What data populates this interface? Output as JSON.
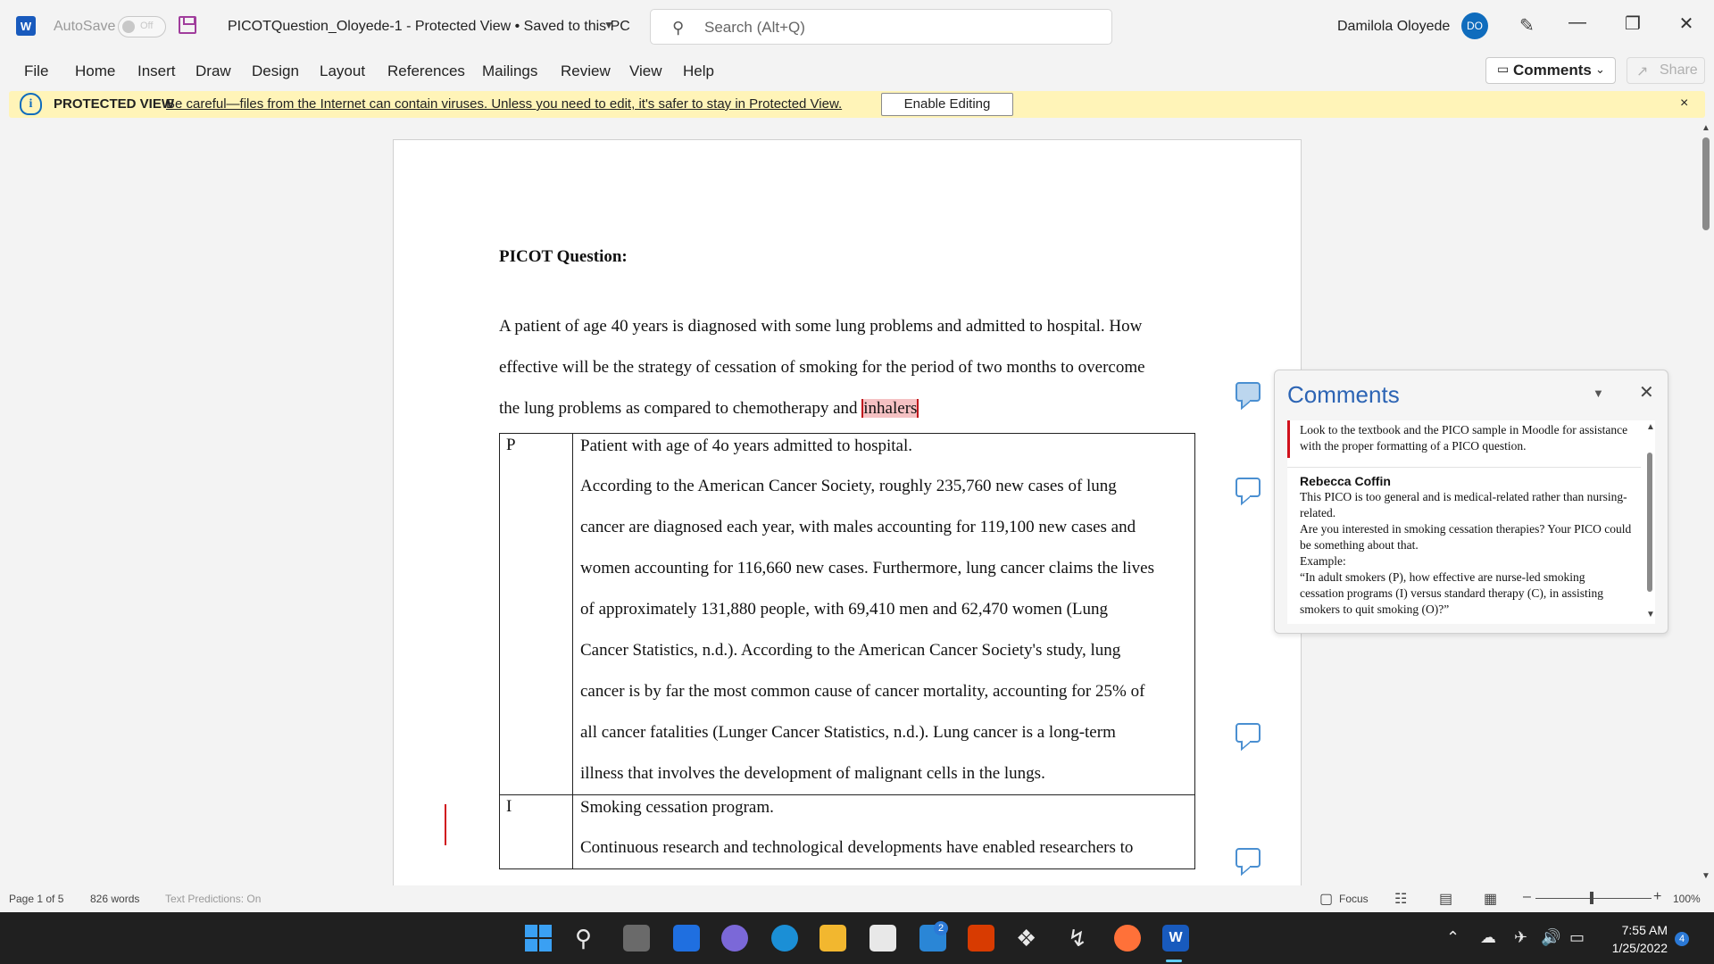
{
  "titlebar": {
    "app_logo": "W",
    "autosave_label": "AutoSave",
    "autosave_state": "Off",
    "doc_title": "PICOTQuestion_Oloyede-1  -  Protected View • Saved to this PC",
    "search_placeholder": "Search (Alt+Q)",
    "user_name": "Damilola  Oloyede",
    "user_initials": "DO"
  },
  "menu": {
    "items": [
      "File",
      "Home",
      "Insert",
      "Draw",
      "Design",
      "Layout",
      "References",
      "Mailings",
      "Review",
      "View",
      "Help"
    ],
    "comments_label": "Comments",
    "share_label": "Share"
  },
  "protected_view": {
    "title": "PROTECTED VIEW",
    "message": "Be careful—files from the Internet can contain viruses. Unless you need to edit, it's safer to stay in Protected View.",
    "button": "Enable Editing",
    "close": "×"
  },
  "document": {
    "heading": "PICOT Question:",
    "para_lines": [
      "A patient of age 40 years is diagnosed with some lung problems and admitted to hospital. How",
      "effective will be the strategy of cessation of smoking for the period of two months to overcome",
      "the lung problems as compared to chemotherapy and "
    ],
    "highlight_word": "inhalers",
    "table": [
      {
        "label": "P",
        "first": "Patient with age of 4o years admitted to hospital.",
        "lines": [
          "According to the American Cancer Society, roughly 235,760 new cases of lung",
          "cancer are diagnosed each year, with males accounting for 119,100 new cases and",
          "women accounting for 116,660 new cases. Furthermore, lung cancer claims the lives",
          "of approximately 131,880 people, with 69,410 men and 62,470 women (Lung",
          "Cancer Statistics, n.d.). According to the American Cancer Society's study, lung",
          "cancer is by far the most common cause of cancer mortality, accounting for 25% of",
          "all cancer fatalities (Lunger Cancer Statistics, n.d.). Lung cancer is a long-term",
          "illness that involves the development of malignant cells in the lungs."
        ]
      },
      {
        "label": "I",
        "first": "Smoking cessation program.",
        "lines": [
          "Continuous research and technological developments have enabled researchers to"
        ]
      }
    ]
  },
  "comments_pane": {
    "title": "Comments",
    "comment1": "Look to the textbook and the PICO sample in Moodle for assistance with the proper formatting of a PICO question.",
    "author2": "Rebecca Coffin",
    "comment2_lines": [
      "This PICO is too general and is medical-related rather than nursing-related.",
      "Are you interested in smoking cessation therapies? Your PICO could be something about that.",
      "Example:",
      "“In adult smokers (P), how effective are nurse-led smoking cessation programs (I) versus standard therapy (C), in assisting smokers to quit smoking (O)?”"
    ]
  },
  "statusbar": {
    "page": "Page 1 of 5",
    "words": "826 words",
    "predictions": "Text Predictions: On",
    "focus": "Focus",
    "zoom": "100%"
  },
  "taskbar": {
    "teams_badge": "2",
    "time": "7:55 AM",
    "date": "1/25/2022",
    "notif_badge": "4"
  },
  "colors": {
    "word_blue": "#185abd",
    "pv_yellow": "#fff4b8",
    "comment_title": "#2c64b4",
    "highlight": "#f5c1c3",
    "redline": "#d0111c"
  }
}
